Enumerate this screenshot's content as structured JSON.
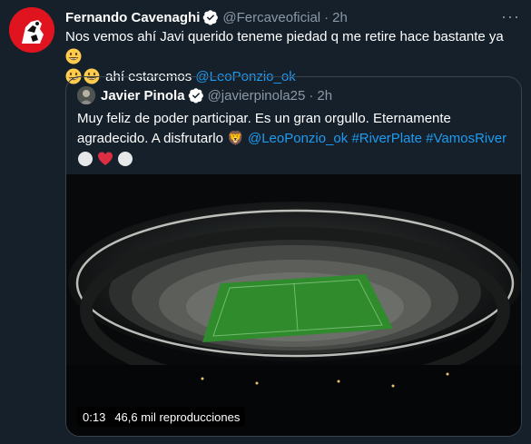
{
  "tweet": {
    "name": "Fernando Cavenaghi",
    "handle": "@Fercaveoficial",
    "dot": "·",
    "time": "2h",
    "more": "···",
    "text_part1": "Nos vemos ahí Javi querido teneme piedad q me retire hace bastante ya ",
    "text_part2": " ahí estaremos ",
    "mention": "@LeoPonzio_ok",
    "emojis_line1": [
      "grinning-face"
    ],
    "emojis_line2": [
      "grinning-face",
      "grinning-face"
    ]
  },
  "quote": {
    "name": "Javier Pinola",
    "handle": "@javierpinola25",
    "dot": "·",
    "time": "2h",
    "text": "Muy feliz de poder participar. Es un gran orgullo. Eternamente agradecido. A disfrutarlo ",
    "lion_emoji": "🦁",
    "mention": "@LeoPonzio_ok",
    "hashtag1": "#RiverPlate",
    "hashtag2": "#VamosRiver",
    "emoji_row": [
      "white-circle",
      "red-heart",
      "white-circle"
    ],
    "video": {
      "duration": "0:13",
      "views": "46,6 mil reproducciones"
    }
  },
  "colors": {
    "background": "#15202b",
    "accent": "#1d9bf0",
    "secondary_text": "#8b98a5",
    "border": "#38444d"
  }
}
